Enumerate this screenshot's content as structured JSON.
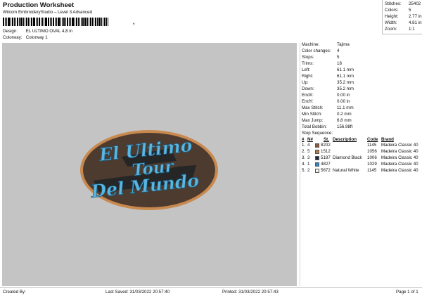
{
  "header": {
    "title": "Production Worksheet",
    "subtitle": "Wilcom EmbroideryStudio – Level 3 Advanced",
    "barcode_mark": ",",
    "design_label": "Design:",
    "design_value": "EL ULTIMO OVAL 4,8 in",
    "colorway_label": "Colorway:",
    "colorway_value": "Colorway 1"
  },
  "stats": [
    {
      "label": "Stitches:",
      "value": "25402"
    },
    {
      "label": "Colors:",
      "value": "5"
    },
    {
      "label": "Height:",
      "value": "2.77 in"
    },
    {
      "label": "Width:",
      "value": "4.81 in"
    },
    {
      "label": "Zoom:",
      "value": "1:1"
    }
  ],
  "design": {
    "line1": "El Ultimo",
    "line2": "Tour",
    "line3": "Del Mundo",
    "colors": {
      "outer_border": "#c8894e",
      "fill": "#4d3b2f",
      "text": "#5bb7e0",
      "text_outline": "#1d5f86",
      "shadow": "#262626",
      "canvas": "#c4c4c4"
    }
  },
  "machine_info": [
    {
      "label": "Machine:",
      "value": "Tajima"
    },
    {
      "label": "Color changes:",
      "value": "4"
    },
    {
      "label": "Stops:",
      "value": "5"
    },
    {
      "label": "Trims:",
      "value": "18"
    },
    {
      "label": "Left:",
      "value": "61.1 mm"
    },
    {
      "label": "Right:",
      "value": "61.1 mm"
    },
    {
      "label": "Up:",
      "value": "35.2 mm"
    },
    {
      "label": "Down:",
      "value": "35.2 mm"
    },
    {
      "label": "EndX:",
      "value": "0.00 in"
    },
    {
      "label": "EndY:",
      "value": "0.00 in"
    },
    {
      "label": "Max Stitch:",
      "value": "11.1 mm"
    },
    {
      "label": "Min Stitch:",
      "value": "0.2 mm"
    },
    {
      "label": "Max Jump:",
      "value": "6.8 mm"
    },
    {
      "label": "Total Bobbin:",
      "value": "156.98ft"
    }
  ],
  "stop_sequence": {
    "title": "Stop Sequence:",
    "headers": {
      "hash": "#",
      "n": "N#",
      "st": "St.",
      "description": "Description",
      "code": "Code",
      "brand": "Brand"
    },
    "rows": [
      {
        "num": "1.",
        "n": "4",
        "color": "#8a5a3c",
        "st": "8202",
        "description": "",
        "code": "1145",
        "brand": "Madeira Classic 40"
      },
      {
        "num": "2.",
        "n": "5",
        "color": "#b07c4e",
        "st": "1512",
        "description": "",
        "code": "1056",
        "brand": "Madeira Classic 40"
      },
      {
        "num": "3.",
        "n": "3",
        "color": "#1e2a3a",
        "st": "5187",
        "description": "Diamond Black",
        "code": "1006",
        "brand": "Madeira Classic 40"
      },
      {
        "num": "4.",
        "n": "1",
        "color": "#2f86c0",
        "st": "4827",
        "description": "",
        "code": "1029",
        "brand": "Madeira Classic 40"
      },
      {
        "num": "5.",
        "n": "2",
        "color": "#f4f1e8",
        "st": "5672",
        "description": "Natural White",
        "code": "1145",
        "brand": "Madeira Classic 40"
      }
    ]
  },
  "footer": {
    "created_by": "Created By:",
    "last_saved": "Last Saved: 31/03/2022 20:57:40",
    "printed": "Printed: 31/03/2022 20:57:43",
    "page": "Page 1 of 1"
  }
}
